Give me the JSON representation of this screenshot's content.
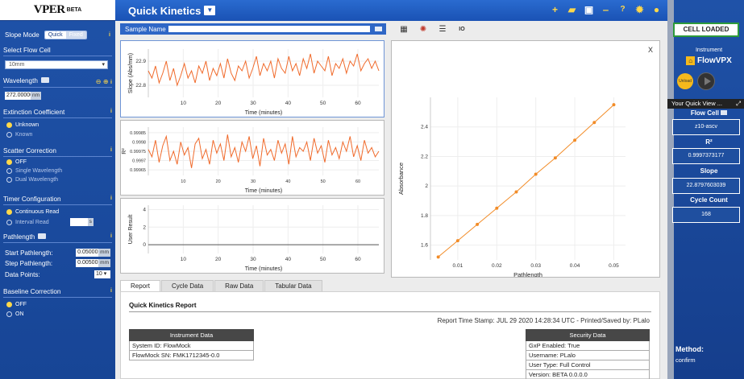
{
  "app": {
    "logo": "VPER",
    "logo_sub": "BETA",
    "title": "Quick Kinetics"
  },
  "left": {
    "slope_mode": {
      "label": "Slope Mode",
      "quick": "Quick",
      "fixed": "Fixed"
    },
    "flow_cell": {
      "label": "Select Flow Cell",
      "value": "10mm"
    },
    "wavelength": {
      "label": "Wavelength",
      "value": "272.00000",
      "unit": "nm"
    },
    "extinction": {
      "label": "Extinction Coefficient",
      "opt1": "Unknown",
      "opt2": "Known"
    },
    "scatter": {
      "label": "Scatter Correction",
      "opt1": "OFF",
      "opt2": "Single Wavelength",
      "opt3": "Dual Wavelength"
    },
    "timer": {
      "label": "Timer Configuration",
      "opt1": "Continuous Read",
      "opt2": "Interval Read",
      "interval_unit": "s"
    },
    "pathlength": {
      "label": "Pathlength",
      "start_label": "Start Pathlength:",
      "start_value": "0.05000",
      "start_unit": "mm",
      "step_label": "Step Pathlength:",
      "step_value": "0.00500",
      "step_unit": "mm",
      "points_label": "Data Points:",
      "points_value": "10"
    },
    "baseline": {
      "label": "Baseline Correction",
      "opt1": "OFF",
      "opt2": "ON"
    }
  },
  "main": {
    "sample_label": "Sample Name",
    "sample_value": "",
    "tabs": [
      "Report",
      "Cycle Data",
      "Raw Data",
      "Tabular Data"
    ],
    "report": {
      "title": "Quick Kinetics Report",
      "stamp": "Report Time Stamp: JUL 29 2020 14:28:34 UTC - Printed/Saved by: PLalo",
      "instrument_header": "Instrument Data",
      "instrument_rows": [
        "System ID: FlowMock",
        "FlowMock SN: FMK1712345-0.0"
      ],
      "security_header": "Security Data",
      "security_rows": [
        "GxP Enabled: True",
        "Username: PLalo",
        "User Type: Full Control",
        "Version: BETA 0.0.0.0"
      ]
    },
    "close_label": "X"
  },
  "chart_data": [
    {
      "type": "line",
      "ylabel": "Slope (Abs/mm)",
      "xlabel": "Time (minutes)",
      "xticks": [
        10,
        20,
        30,
        40,
        50,
        60
      ],
      "yticks": [
        22.8,
        22.9
      ],
      "xlim": [
        0,
        66
      ],
      "ylim": [
        22.75,
        22.95
      ],
      "color": "#f06a2b",
      "series": [
        {
          "values": [
            22.86,
            22.83,
            22.88,
            22.81,
            22.85,
            22.9,
            22.82,
            22.87,
            22.8,
            22.84,
            22.89,
            22.83,
            22.86,
            22.81,
            22.88,
            22.85,
            22.9,
            22.82,
            22.87,
            22.84,
            22.89,
            22.83,
            22.91,
            22.85,
            22.82,
            22.88,
            22.86,
            22.9,
            22.83,
            22.87,
            22.92,
            22.84,
            22.89,
            22.86,
            22.9,
            22.83,
            22.91,
            22.87,
            22.85,
            22.92,
            22.86,
            22.89,
            22.84,
            22.91,
            22.87,
            22.93,
            22.85,
            22.9,
            22.88,
            22.86,
            22.92,
            22.84,
            22.89,
            22.87,
            22.91,
            22.85,
            22.9,
            22.88,
            22.93,
            22.86,
            22.89,
            22.91,
            22.87,
            22.9,
            22.86
          ]
        }
      ]
    },
    {
      "type": "line",
      "ylabel": "R²",
      "xlabel": "Time (minutes)",
      "xticks": [
        10,
        20,
        30,
        40,
        50,
        60
      ],
      "yticks": [
        0.99965,
        0.9997,
        0.99975,
        0.9998,
        0.99985
      ],
      "xlim": [
        0,
        66
      ],
      "ylim": [
        0.99962,
        0.99988
      ],
      "color": "#f06a2b",
      "series": [
        {
          "values": [
            0.99976,
            0.99972,
            0.99981,
            0.99969,
            0.99978,
            0.99983,
            0.9997,
            0.99975,
            0.99968,
            0.9998,
            0.99973,
            0.99977,
            0.99966,
            0.99979,
            0.99982,
            0.99971,
            0.99976,
            0.99968,
            0.99981,
            0.99974,
            0.99979,
            0.9997,
            0.99984,
            0.99972,
            0.99977,
            0.99969,
            0.9998,
            0.99975,
            0.99983,
            0.99971,
            0.99978,
            0.99967,
            0.99982,
            0.99973,
            0.99976,
            0.9997,
            0.99981,
            0.99974,
            0.99979,
            0.99968,
            0.99983,
            0.99972,
            0.99977,
            0.99975,
            0.9998,
            0.9997,
            0.99982,
            0.99974,
            0.99978,
            0.99969,
            0.99981,
            0.99973,
            0.99977,
            0.99971,
            0.9998,
            0.99975,
            0.99983,
            0.99972,
            0.99978,
            0.9997,
            0.99981,
            0.99974,
            0.99977,
            0.99972,
            0.99975
          ]
        }
      ]
    },
    {
      "type": "line",
      "ylabel": "User Result",
      "xlabel": "Time (minutes)",
      "xticks": [
        10,
        20,
        30,
        40,
        50,
        60
      ],
      "yticks": [
        0,
        2,
        4
      ],
      "xlim": [
        0,
        66
      ],
      "ylim": [
        -1,
        4.5
      ],
      "color": "#555555",
      "series": [
        {
          "values": [
            0,
            0
          ]
        }
      ]
    },
    {
      "type": "line",
      "ylabel": "Absorbance",
      "xlabel": "Pathlength",
      "xticks": [
        0.01,
        0.02,
        0.03,
        0.04,
        0.05
      ],
      "yticks": [
        1.6,
        1.8,
        2,
        2.2,
        2.4
      ],
      "xlim": [
        0.003,
        0.053
      ],
      "ylim": [
        1.5,
        2.6
      ],
      "color": "#f28c28",
      "x": [
        0.005,
        0.01,
        0.015,
        0.02,
        0.025,
        0.03,
        0.035,
        0.04,
        0.045,
        0.05
      ],
      "series": [
        {
          "values": [
            1.52,
            1.63,
            1.74,
            1.85,
            1.96,
            2.08,
            2.19,
            2.31,
            2.43,
            2.55
          ]
        }
      ]
    }
  ],
  "right": {
    "cell_loaded": "CELL LOADED",
    "instrument_label": "Instrument",
    "instrument_name": "FlowVPX",
    "unload_label": "Unload",
    "quick_view": "Your Quick View ...",
    "flow_cell_label": "Flow Cell",
    "flow_cell_value": "z10-ascv",
    "r2_label": "R²",
    "r2_value": "0.9997373177",
    "slope_label": "Slope",
    "slope_value": "22.8797603039",
    "cycle_label": "Cycle Count",
    "cycle_value": "168",
    "method_label": "Method:",
    "method_value": "confirm"
  }
}
